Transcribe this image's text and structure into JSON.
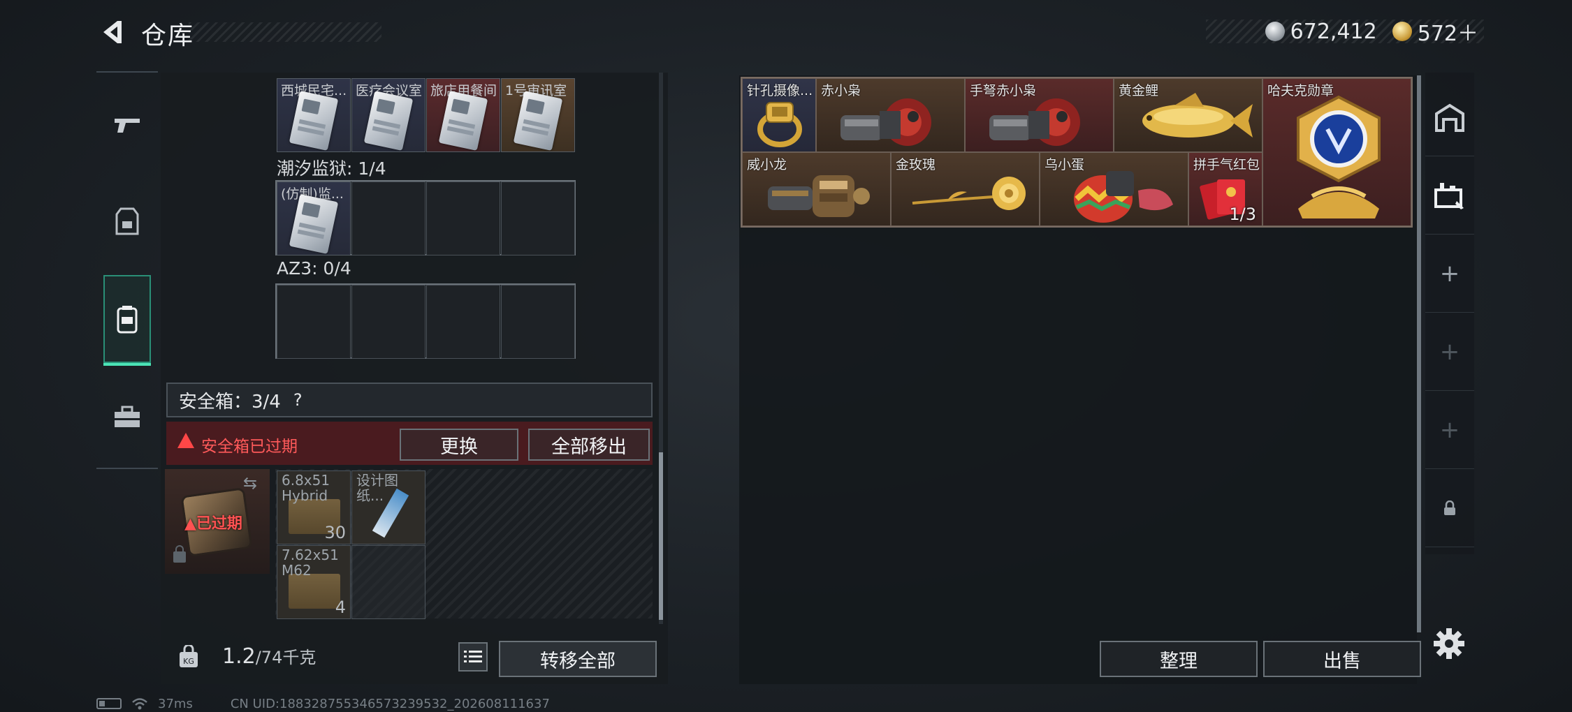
{
  "header": {
    "title": "仓库"
  },
  "currency": {
    "silver": "672,412",
    "gold": "572＋"
  },
  "left_nav": {
    "items": [
      "weapons",
      "armor",
      "backpack",
      "toolbox"
    ],
    "active": 2
  },
  "keys": {
    "row1": [
      {
        "name": "西城民宅...",
        "rarity": "blue"
      },
      {
        "name": "医疗会议室",
        "rarity": "blue"
      },
      {
        "name": "旅店用餐间",
        "rarity": "red"
      },
      {
        "name": "1号审讯室",
        "rarity": "orange"
      }
    ],
    "group2_label": "潮汐监狱: 1/4",
    "row2": [
      {
        "name": "(仿制)监...",
        "rarity": "blue"
      }
    ],
    "group3_label": "AZ3: 0/4"
  },
  "safebox": {
    "label": "安全箱：3/4",
    "help": "?",
    "expired_warning": "安全箱已过期",
    "replace_button": "更换",
    "move_all_button": "全部移出",
    "case_status": "已过期",
    "items": [
      {
        "name": "6.8x51 Hybrid",
        "count": "30"
      },
      {
        "name": "设计图纸...",
        "count": ""
      },
      {
        "name": "7.62x51 M62",
        "count": "4"
      }
    ]
  },
  "footer_left": {
    "weight": "1.2",
    "weight_total": "/74千克",
    "transfer_all_button": "转移全部"
  },
  "stash_items": [
    {
      "name": "针孔摄像...",
      "rarity": "blue",
      "icon": "gold-ring"
    },
    {
      "name": "赤小枭",
      "rarity": "orange",
      "icon": "red-gauntlet"
    },
    {
      "name": "手弩赤小枭",
      "rarity": "red",
      "icon": "red-gauntlet"
    },
    {
      "name": "黄金鲤",
      "rarity": "orange",
      "icon": "golden-carp"
    },
    {
      "name": "哈夫克勋章",
      "rarity": "red",
      "icon": "haavk-medal"
    },
    {
      "name": "威小龙",
      "rarity": "orange",
      "icon": "dragon-gauntlet"
    },
    {
      "name": "金玫瑰",
      "rarity": "orange",
      "icon": "golden-rose"
    },
    {
      "name": "乌小蛋",
      "rarity": "orange",
      "icon": "egg-mech"
    },
    {
      "name": "拼手气红包",
      "rarity": "red",
      "icon": "red-envelope",
      "count": "1/3"
    }
  ],
  "footer_right": {
    "sort_button": "整理",
    "sell_button": "出售"
  },
  "status_bar": {
    "ping": "37ms",
    "uid": "CN UID:188328755346573239532_202608111637"
  }
}
